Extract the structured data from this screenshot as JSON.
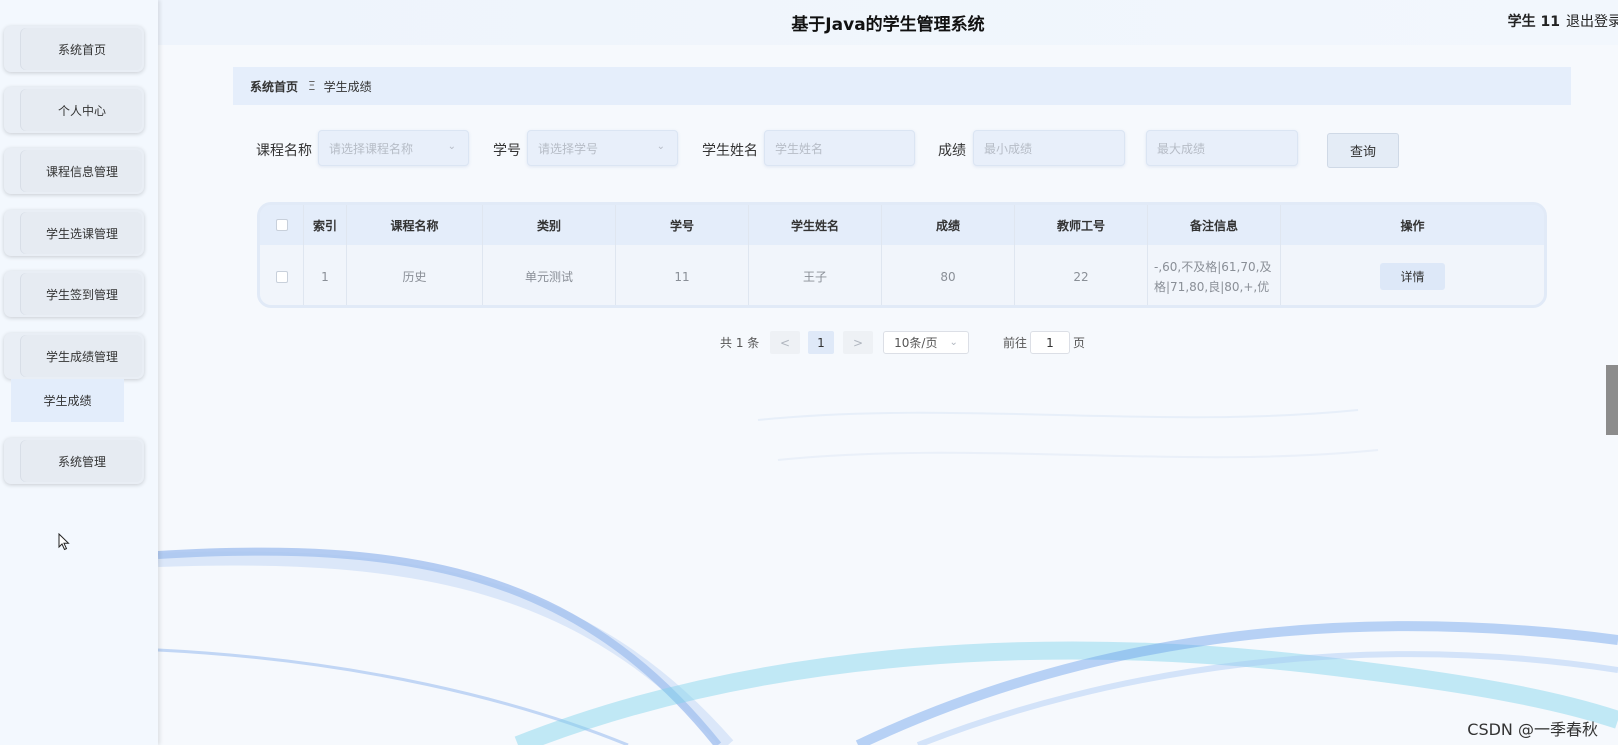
{
  "header": {
    "title": "基于Java的学生管理系统",
    "user": "学生 11",
    "logout": "退出登录"
  },
  "sidebar": {
    "items": [
      {
        "label": "系统首页"
      },
      {
        "label": "个人中心"
      },
      {
        "label": "课程信息管理"
      },
      {
        "label": "学生选课管理"
      },
      {
        "label": "学生签到管理"
      },
      {
        "label": "学生成绩管理"
      },
      {
        "label": "系统管理"
      }
    ],
    "submenu": {
      "label": "学生成绩"
    }
  },
  "breadcrumb": {
    "home": "系统首页",
    "separator": "Ξ",
    "current": "学生成绩"
  },
  "search": {
    "course_label": "课程名称",
    "course_placeholder": "请选择课程名称",
    "student_id_label": "学号",
    "student_id_placeholder": "请选择学号",
    "student_name_label": "学生姓名",
    "student_name_placeholder": "学生姓名",
    "score_label": "成绩",
    "score_min_placeholder": "最小成绩",
    "score_max_placeholder": "最大成绩",
    "query_button": "查询"
  },
  "table": {
    "columns": [
      "索引",
      "课程名称",
      "类别",
      "学号",
      "学生姓名",
      "成绩",
      "教师工号",
      "备注信息",
      "操作"
    ],
    "rows": [
      {
        "index": "1",
        "course": "历史",
        "category": "单元测试",
        "student_id": "11",
        "student_name": "王子",
        "score": "80",
        "teacher_id": "22",
        "remark": "-,60,不及格|61,70,及格|71,80,良|80,+,优",
        "action": "详情"
      }
    ]
  },
  "pagination": {
    "total": "共 1 条",
    "prev": "<",
    "current_page": "1",
    "next": ">",
    "page_size": "10条/页",
    "goto_label": "前往",
    "goto_value": "1",
    "page_unit": "页"
  },
  "watermark": "CSDN @一季春秋",
  "colors": {
    "accent": "#e4edfa",
    "sidebar_bg": "#f3f8fe"
  }
}
